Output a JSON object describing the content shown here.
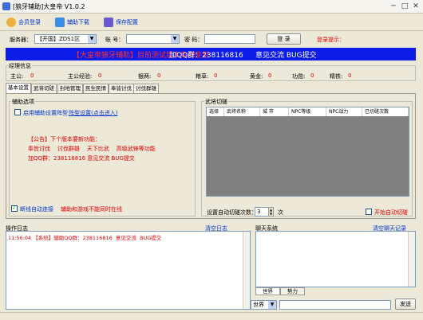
{
  "window": {
    "title": "[狼牙辅助]大皇帝 V1.0.2",
    "minimize": "─",
    "maximize": "□",
    "close": "✕"
  },
  "toolbar": {
    "login": "会员登录",
    "download": "辅助下载",
    "save": "保存配置",
    "icon_login": "user-icon",
    "icon_download": "download-icon",
    "icon_save": "save-icon"
  },
  "login": {
    "server_label": "服务器：",
    "server_value": "【开国】ZDS1区",
    "account_label": "账 号：",
    "account_value": "",
    "password_label": "密 码：",
    "password_value": "",
    "login_button": "登 录",
    "login_hint": "登录提示："
  },
  "banner": {
    "left": "【大皇帝狼牙辅助】目前测试版本免费使用",
    "mid": "加QQ群：238116816",
    "right": "意见交流 BUG提交"
  },
  "profile": {
    "section_title": "经理信息",
    "stats": [
      {
        "label": "主公:",
        "value": "0"
      },
      {
        "label": "主公经验:",
        "value": "0"
      },
      {
        "label": "银两:",
        "value": "0"
      },
      {
        "label": "粮草:",
        "value": "0"
      },
      {
        "label": "黄金:",
        "value": "0"
      },
      {
        "label": "功勋:",
        "value": "0"
      },
      {
        "label": "精铁:",
        "value": "0"
      }
    ]
  },
  "tabs": [
    "基本设置",
    "武将切磋",
    "封地管理",
    "民生民情",
    "奉皆讨伐",
    "讨伐群雄"
  ],
  "assist": {
    "title": "辅助选项",
    "enable_label": "启用辅助设置阵型",
    "link_label": "阵型设置(点击进入)",
    "notice_title": "【公告】下个版本要新功能：",
    "notice_line1": "奉皆讨伐    讨伐群雄    天下比武    高级武锋等功能",
    "notice_line2": "加QQ群：238116816  意见交流 BUG提交",
    "auto_reconnect": "断线自动连接",
    "auto_reconnect_note": "辅助和游戏不能同时在线",
    "auto_reconnect_checked": true
  },
  "duel": {
    "title": "武将切磋",
    "columns": [
      "选择",
      "武将名称",
      "城 市",
      "NPC等级",
      "NPC战力",
      "已切磋次数"
    ],
    "count_label": "设置自动切磋次数：",
    "count_value": "3",
    "count_unit": "次",
    "auto_duel_label": "开始自动切磋"
  },
  "log": {
    "title": "操作日志",
    "clear": "清空日志",
    "entries": [
      {
        "time": "11:56:04",
        "text": "【系统】辅助QQ群：238116816  意见交流  BUG提交"
      }
    ]
  },
  "chat": {
    "title": "聊天系统",
    "clear": "清空聊天记录",
    "tab_world": "世界",
    "tab_force": "势力",
    "channel": "世界",
    "input_value": "",
    "send": "发送"
  },
  "colors": {
    "window_bg": "#ece9d8",
    "banner_bg": "#0d1ce6",
    "banner_red": "#ff3030",
    "accent_red": "#e00000",
    "link_blue": "#0033cc",
    "list_bg": "#808080"
  }
}
